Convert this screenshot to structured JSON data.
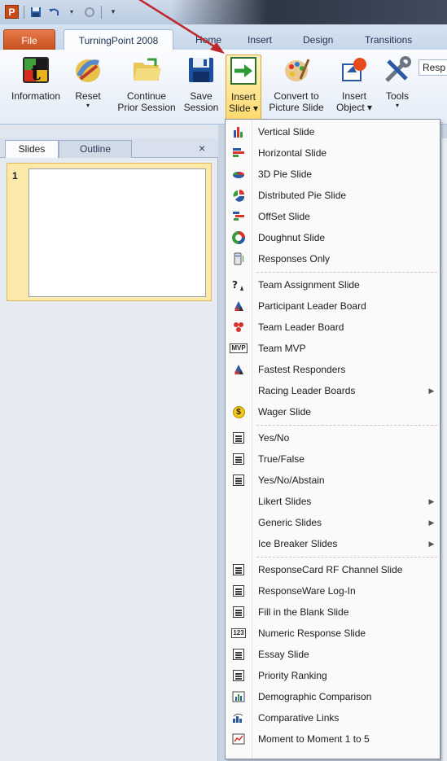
{
  "qat": {
    "logo_letter": "P"
  },
  "tabs": {
    "file": "File",
    "turningpoint": "TurningPoint 2008",
    "home": "Home",
    "insert": "Insert",
    "design": "Design",
    "transitions": "Transitions"
  },
  "ribbon": {
    "information": "Information",
    "reset": "Reset",
    "continue_1": "Continue",
    "continue_2": "Prior Session",
    "save_1": "Save",
    "save_2": "Session",
    "insert_slide_1": "Insert",
    "insert_slide_2": "Slide ▾",
    "convert_1": "Convert to",
    "convert_2": "Picture Slide",
    "insert_object_1": "Insert",
    "insert_object_2": "Object ▾",
    "tools": "Tools",
    "responses_box": "Resp",
    "dropdown_mark": "▾"
  },
  "pane": {
    "slides_tab": "Slides",
    "outline_tab": "Outline",
    "close": "×",
    "slide_number": "1"
  },
  "menu": {
    "items": [
      {
        "label": "Vertical Slide",
        "icon": "vertical-bar-chart-icon"
      },
      {
        "label": "Horizontal Slide",
        "icon": "horizontal-bar-chart-icon"
      },
      {
        "label": "3D Pie Slide",
        "icon": "3d-pie-icon"
      },
      {
        "label": "Distributed Pie Slide",
        "icon": "distributed-pie-icon"
      },
      {
        "label": "OffSet Slide",
        "icon": "offset-chart-icon"
      },
      {
        "label": "Doughnut Slide",
        "icon": "doughnut-icon"
      },
      {
        "label": "Responses Only",
        "icon": "keypad-icon"
      },
      {
        "label": "Team Assignment Slide",
        "icon": "team-assignment-icon"
      },
      {
        "label": "Participant Leader Board",
        "icon": "participant-leaderboard-icon"
      },
      {
        "label": "Team Leader Board",
        "icon": "team-leaderboard-icon"
      },
      {
        "label": "Team MVP",
        "icon": "mvp-icon",
        "icon_text": "MVP"
      },
      {
        "label": "Fastest Responders",
        "icon": "fastest-responders-icon"
      },
      {
        "label": "Racing Leader Boards",
        "icon": "",
        "submenu": true
      },
      {
        "label": "Wager Slide",
        "icon": "wager-coin-icon",
        "icon_text": "$"
      },
      {
        "label": "Yes/No",
        "icon": "yes-no-icon"
      },
      {
        "label": "True/False",
        "icon": "true-false-icon"
      },
      {
        "label": "Yes/No/Abstain",
        "icon": "yes-no-abstain-icon"
      },
      {
        "label": "Likert Slides",
        "icon": "",
        "submenu": true
      },
      {
        "label": "Generic Slides",
        "icon": "",
        "submenu": true
      },
      {
        "label": "Ice Breaker Slides",
        "icon": "",
        "submenu": true
      },
      {
        "label": "ResponseCard RF Channel Slide",
        "icon": "responsecard-icon"
      },
      {
        "label": "ResponseWare Log-In",
        "icon": "responseware-icon"
      },
      {
        "label": "Fill in the Blank Slide",
        "icon": "fill-blank-icon"
      },
      {
        "label": "Numeric Response Slide",
        "icon": "numeric-icon",
        "icon_text": "123"
      },
      {
        "label": "Essay Slide",
        "icon": "essay-icon"
      },
      {
        "label": "Priority Ranking",
        "icon": "priority-ranking-icon"
      },
      {
        "label": "Demographic Comparison",
        "icon": "demographic-icon"
      },
      {
        "label": "Comparative Links",
        "icon": "comparative-links-icon"
      },
      {
        "label": "Moment to Moment 1 to 5",
        "icon": "moment-icon"
      }
    ],
    "submenu_arrow": "▶"
  },
  "colors": {
    "accent_orange": "#c5501e",
    "highlight": "#ffd96a",
    "annotation": "#c0272d"
  }
}
